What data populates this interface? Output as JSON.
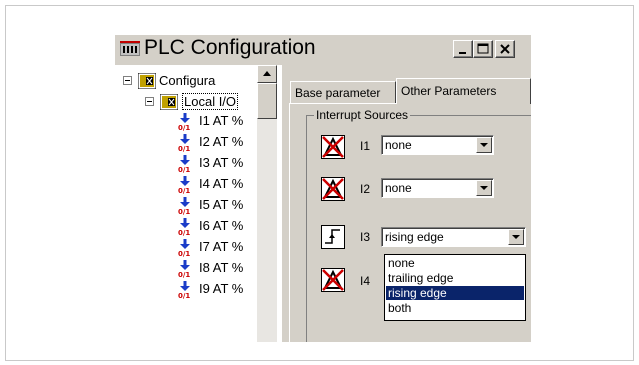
{
  "window": {
    "title": "PLC Configuration",
    "minimize_glyph": "minimize",
    "maximize_glyph": "maximize",
    "close_glyph": "close"
  },
  "tree": {
    "root": {
      "label": "Configura",
      "icon": "config-chip-icon"
    },
    "local_io": {
      "label": "Local I/O",
      "icon": "io-chip-icon"
    },
    "items": [
      {
        "label": "I1 AT %",
        "icon": "digital-input-icon"
      },
      {
        "label": "I2 AT %",
        "icon": "digital-input-icon"
      },
      {
        "label": "I3 AT %",
        "icon": "digital-input-icon"
      },
      {
        "label": "I4 AT %",
        "icon": "digital-input-icon"
      },
      {
        "label": "I5 AT %",
        "icon": "digital-input-icon"
      },
      {
        "label": "I6 AT %",
        "icon": "digital-input-icon"
      },
      {
        "label": "I7 AT %",
        "icon": "digital-input-icon"
      },
      {
        "label": "I8 AT %",
        "icon": "digital-input-icon"
      },
      {
        "label": "I9 AT %",
        "icon": "digital-input-icon"
      }
    ]
  },
  "tabs": [
    {
      "label": "Base parameter",
      "active": false
    },
    {
      "label": "Other Parameters",
      "active": true
    }
  ],
  "interrupts": {
    "group_label": "Interrupt Sources",
    "rows": [
      {
        "label": "I1",
        "value": "none",
        "icon": "interrupt-disabled-icon"
      },
      {
        "label": "I2",
        "value": "none",
        "icon": "interrupt-disabled-icon"
      },
      {
        "label": "I3",
        "value": "rising edge",
        "icon": "rising-edge-icon"
      },
      {
        "label": "I4",
        "value": "",
        "icon": "interrupt-disabled-icon"
      }
    ],
    "dropdown_options": [
      "none",
      "trailing edge",
      "rising edge",
      "both"
    ],
    "dropdown_selected": "rising edge"
  },
  "colors": {
    "window_bg": "#d4d0c8",
    "selection": "#0a246a",
    "icon_red": "#cc0000",
    "icon_blue": "#1a3cc8"
  }
}
